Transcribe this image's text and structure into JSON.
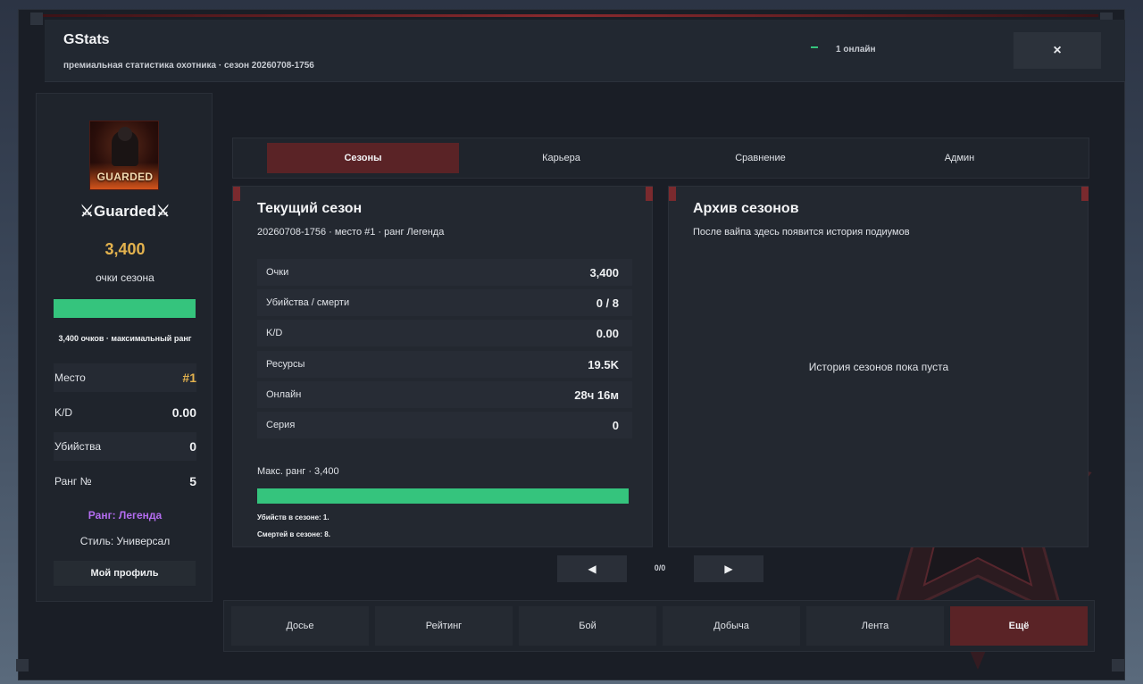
{
  "header": {
    "title": "GStats",
    "subtitle": "премиальная статистика охотника · сезон 20260708-1756",
    "online": "1 онлайн",
    "close_label": "×"
  },
  "profile": {
    "avatar_text": "GUARDED",
    "name": "⚔Guarded⚔",
    "score": "3,400",
    "score_label": "очки сезона",
    "progress": 1.0,
    "score_note": "3,400 очков · максимальный ранг",
    "stats": [
      {
        "label": "Место",
        "value": "#1"
      },
      {
        "label": "K/D",
        "value": "0.00"
      },
      {
        "label": "Убийства",
        "value": "0"
      },
      {
        "label": "Ранг №",
        "value": "5"
      }
    ],
    "rank": "Ранг: Легенда",
    "style": "Стиль: Универсал",
    "profile_button": "Мой профиль"
  },
  "tabs": [
    {
      "label": "Сезоны",
      "active": true
    },
    {
      "label": "Карьера",
      "active": false
    },
    {
      "label": "Сравнение",
      "active": false
    },
    {
      "label": "Админ",
      "active": false
    }
  ],
  "current_season": {
    "title": "Текущий сезон",
    "subtitle": "20260708-1756 · место #1 · ранг Легенда",
    "rows": [
      {
        "label": "Очки",
        "value": "3,400"
      },
      {
        "label": "Убийства / смерти",
        "value": "0 / 8"
      },
      {
        "label": "K/D",
        "value": "0.00"
      },
      {
        "label": "Ресурсы",
        "value": "19.5K"
      },
      {
        "label": "Онлайн",
        "value": "28ч 16м"
      },
      {
        "label": "Серия",
        "value": "0"
      }
    ],
    "max_rank": "Макс. ранг · 3,400",
    "progress": 1.0,
    "kills_note": "Убийств в сезоне: 1.",
    "deaths_note": "Смертей в сезоне: 8."
  },
  "archive": {
    "title": "Архив сезонов",
    "subtitle": "После вайпа здесь появится история подиумов",
    "empty": "История сезонов пока пуста"
  },
  "pager": {
    "prev": "◀",
    "next": "▶",
    "text": "0/0"
  },
  "bottom_nav": [
    {
      "label": "Досье",
      "active": false
    },
    {
      "label": "Рейтинг",
      "active": false
    },
    {
      "label": "Бой",
      "active": false
    },
    {
      "label": "Добыча",
      "active": false
    },
    {
      "label": "Лента",
      "active": false
    },
    {
      "label": "Ещё",
      "active": true
    }
  ],
  "colors": {
    "accent_red": "#5a2326",
    "progress_green": "#35c47d",
    "gold": "#e3b24e",
    "rank_purple": "#b46df0"
  }
}
